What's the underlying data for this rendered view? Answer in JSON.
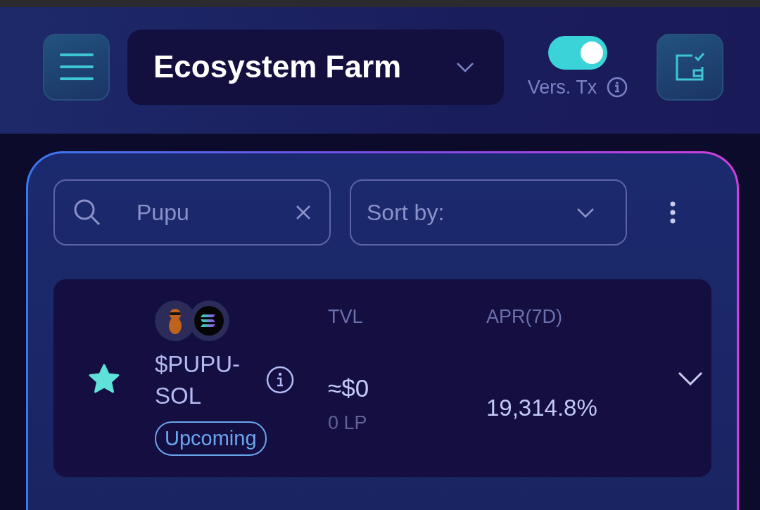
{
  "header": {
    "farm_selector": {
      "value": "Ecosystem Farm"
    },
    "versioned_tx": {
      "label": "Vers. Tx",
      "on": true
    }
  },
  "filters": {
    "search": {
      "value": "Pupu"
    },
    "sort": {
      "placeholder": "Sort by:"
    }
  },
  "farms": [
    {
      "name": "$PUPU-SOL",
      "favorite": true,
      "badge": "Upcoming",
      "tvl_label": "TVL",
      "tvl": "≈$0",
      "lp": "0 LP",
      "apr_label": "APR(7D)",
      "apr": "19,314.8%",
      "expanded": false
    }
  ]
}
